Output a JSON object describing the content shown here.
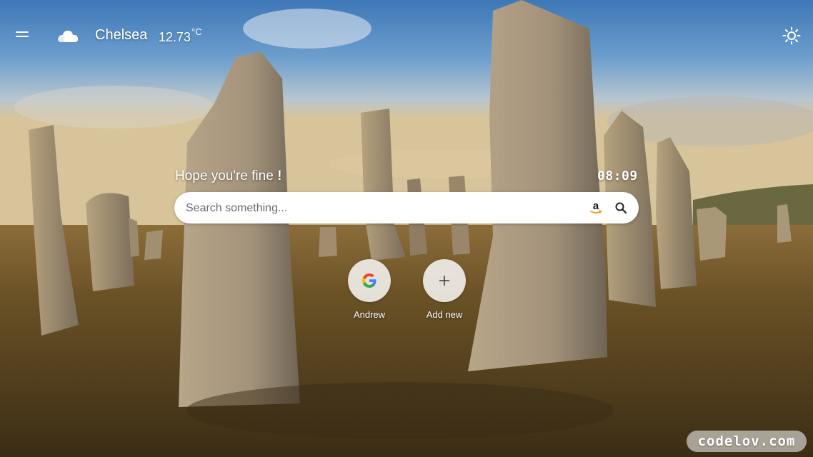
{
  "header": {
    "menu_icon": "hamburger-menu-icon",
    "weather_icon": "cloud-icon",
    "city": "Chelsea",
    "temperature": "12.73",
    "temperature_unit": "°C",
    "theme_icon": "sun-icon"
  },
  "main": {
    "greeting_text": "Hope you're fine ",
    "greeting_mark": "!",
    "clock": "08:09",
    "search": {
      "placeholder": "Search something...",
      "amazon_icon": "amazon-icon",
      "search_icon": "magnifier-icon"
    },
    "shortcuts": [
      {
        "label": "Andrew",
        "icon": "google-icon"
      },
      {
        "label": "Add new",
        "icon": "plus-icon"
      }
    ]
  },
  "watermark": "codelov.com",
  "colors": {
    "search_bg": "#ffffff",
    "text": "#ffffff",
    "shortcut_bg": "#e9e9e9"
  }
}
